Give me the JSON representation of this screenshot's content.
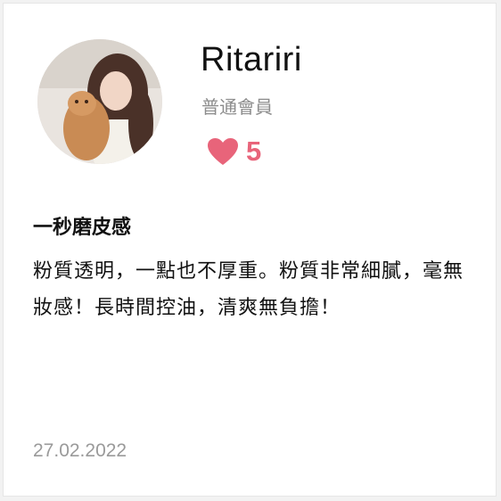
{
  "review": {
    "username": "Ritariri",
    "member_level": "普通會員",
    "likes": "5",
    "title": "一秒磨皮感",
    "body": "粉質透明，一點也不厚重。粉質非常細膩，毫無妝感！長時間控油，清爽無負擔！",
    "date": "27.02.2022"
  },
  "icons": {
    "like": "heart-icon",
    "avatar": "user-avatar"
  },
  "colors": {
    "accent": "#e8647a",
    "muted_text": "#8c8c8c",
    "date_text": "#9a9a9a",
    "card_bg": "#ffffff"
  }
}
